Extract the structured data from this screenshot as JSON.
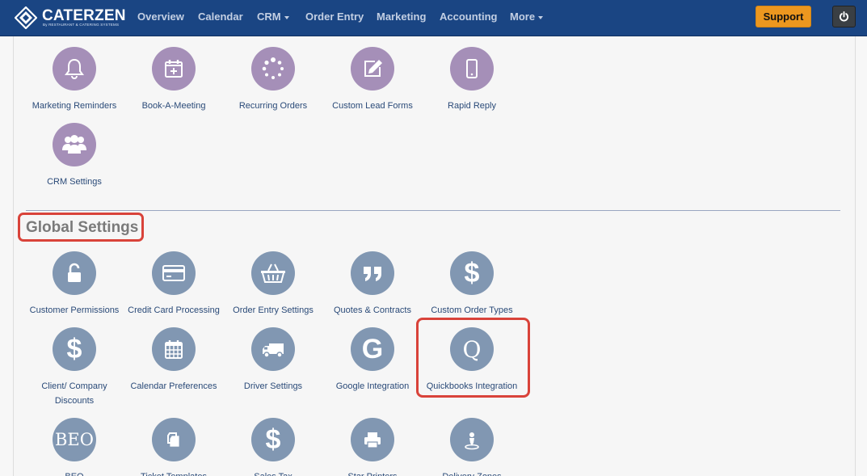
{
  "header": {
    "brand": "CATERZEN",
    "brand_sub": "By RESTAURANT & CATERING SYSTEMS",
    "nav": [
      {
        "label": "Overview"
      },
      {
        "label": "Calendar"
      },
      {
        "label": "CRM"
      },
      {
        "label": "Order Entry"
      },
      {
        "label": "Marketing"
      },
      {
        "label": "Accounting"
      },
      {
        "label": "More"
      }
    ],
    "support_label": "Support"
  },
  "crm_tools": [
    {
      "label": "Marketing Reminders",
      "icon": "bell-icon"
    },
    {
      "label": "Book-A-Meeting",
      "icon": "calendar-plus-icon"
    },
    {
      "label": "Recurring Orders",
      "icon": "spinner-icon"
    },
    {
      "label": "Custom Lead Forms",
      "icon": "edit-icon"
    },
    {
      "label": "Rapid Reply",
      "icon": "mobile-icon"
    },
    {
      "label": "CRM Settings",
      "icon": "users-icon"
    }
  ],
  "global_settings": {
    "title": "Global Settings",
    "items": [
      {
        "label": "Customer Permissions",
        "icon": "unlock-icon"
      },
      {
        "label": "Credit Card Processing",
        "icon": "credit-card-icon"
      },
      {
        "label": "Order Entry Settings",
        "icon": "basket-icon"
      },
      {
        "label": "Quotes & Contracts",
        "icon": "quote-icon"
      },
      {
        "label": "Custom Order Types",
        "icon": "dollar-icon"
      },
      {
        "label": "Client/ Company Discounts",
        "icon": "dollar-icon"
      },
      {
        "label": "Calendar Preferences",
        "icon": "calendar-icon"
      },
      {
        "label": "Driver Settings",
        "icon": "truck-icon"
      },
      {
        "label": "Google Integration",
        "icon": "google-icon",
        "glyph": "G"
      },
      {
        "label": "Quickbooks Integration",
        "icon": "quickbooks-icon",
        "glyph": "Q"
      },
      {
        "label": "BEO",
        "icon": "beo-icon",
        "glyph": "BEO"
      },
      {
        "label": "Ticket Templates",
        "icon": "copy-icon"
      },
      {
        "label": "Sales Tax",
        "icon": "dollar-icon"
      },
      {
        "label": "Star Printers",
        "icon": "printer-icon"
      },
      {
        "label": "Delivery Zones",
        "icon": "map-pin-icon"
      }
    ]
  },
  "colors": {
    "navbar": "#1a4583",
    "crm_icon_bg": "#a58fb8",
    "settings_icon_bg": "#8197b2",
    "support_button": "#ec971f",
    "highlight": "#d9433a",
    "link_text": "#2a4a78"
  }
}
